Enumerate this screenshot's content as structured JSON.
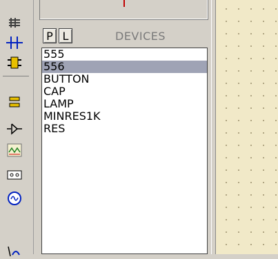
{
  "toolbar": {
    "tools": [
      {
        "icon": "component-icon"
      },
      {
        "icon": "junction-dot-icon"
      },
      {
        "icon": "wire-label-icon"
      },
      {
        "icon": "text-script-icon"
      },
      {
        "icon": "bus-icon"
      },
      {
        "icon": "subcircuit-icon"
      },
      {
        "icon": "terminal-icon"
      },
      {
        "icon": "device-pin-icon"
      },
      {
        "icon": "graph-icon"
      },
      {
        "icon": "tape-recorder-icon"
      },
      {
        "icon": "generator-icon"
      },
      {
        "icon": "voltage-probe-icon"
      }
    ]
  },
  "devices": {
    "pick_button": "P",
    "library_button": "L",
    "title": "DEVICES",
    "items": [
      "555",
      "556",
      "BUTTON",
      "CAP",
      "LAMP",
      "MINRES1K",
      "RES"
    ],
    "selected_index": 1
  },
  "colors": {
    "panel": "#d4d0c8",
    "selection": "#9fa3b5",
    "canvas": "#f1e9c8"
  }
}
